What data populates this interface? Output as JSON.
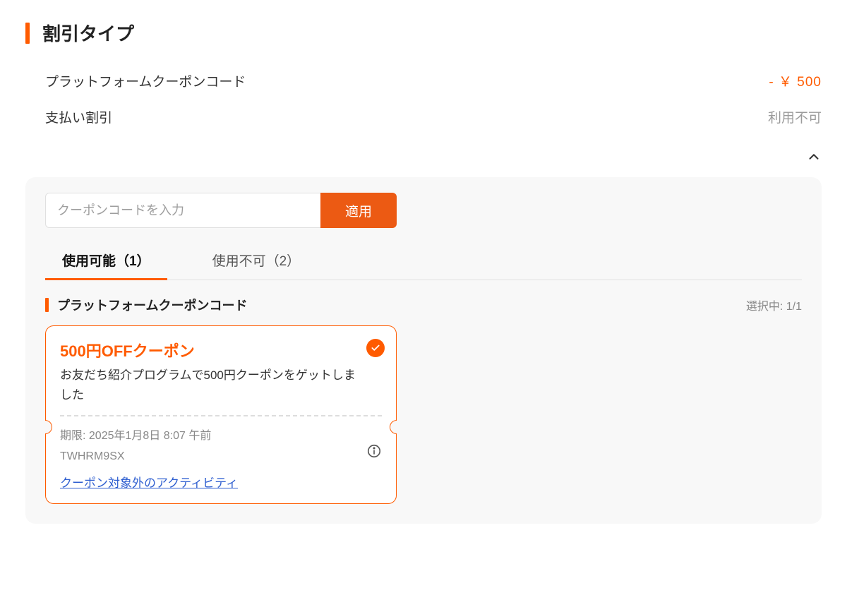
{
  "header": {
    "title": "割引タイプ"
  },
  "discounts": {
    "platform_coupon_label": "プラットフォームクーポンコード",
    "platform_coupon_value": "- ￥ 500",
    "payment_discount_label": "支払い割引",
    "payment_discount_value": "利用不可"
  },
  "input": {
    "placeholder": "クーポンコードを入力",
    "apply_label": "適用"
  },
  "tabs": {
    "available": "使用可能（1）",
    "unavailable": "使用不可（2）"
  },
  "subheader": {
    "title": "プラットフォームクーポンコード",
    "selected": "選択中: 1/1"
  },
  "coupon": {
    "title": "500円OFFクーポン",
    "desc": "お友だち紹介プログラムで500円クーポンをゲットしました",
    "expiry": "期限: 2025年1月8日 8:07 午前",
    "code": "TWHRM9SX",
    "exclusions_label": "クーポン対象外のアクティビティ"
  },
  "colors": {
    "accent": "#ff5b00"
  }
}
